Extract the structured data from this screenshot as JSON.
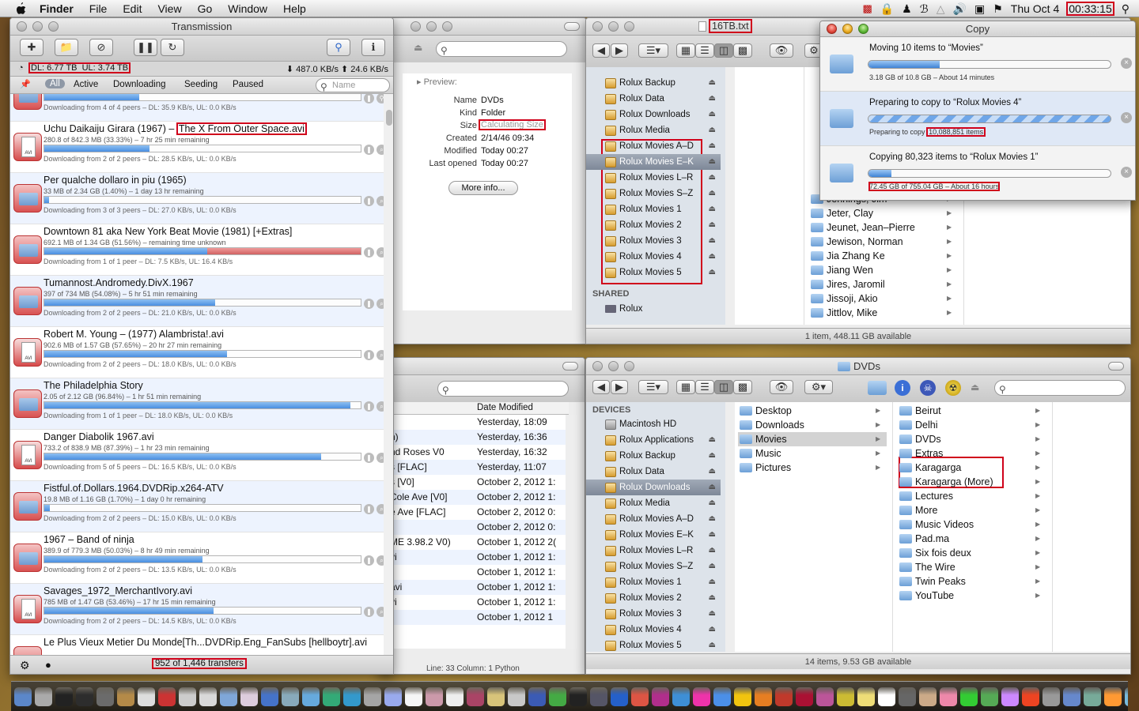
{
  "menubar": {
    "app": "Finder",
    "menus": [
      "File",
      "Edit",
      "View",
      "Go",
      "Window",
      "Help"
    ],
    "clock_date": "Thu Oct 4",
    "clock_time": "00:33:15"
  },
  "transmission": {
    "title": "Transmission",
    "totals": "DL: 6.77 TB  UL: 3.74 TB",
    "rates": "⬇ 487.0 KB/s ⬆ 24.6 KB/s",
    "filters": [
      "All",
      "Active",
      "Downloading",
      "Seeding",
      "Paused"
    ],
    "search_placeholder": "Name",
    "footer": "952 of 1,446 transfers",
    "top_partial_peer": "Downloading from 4 of 4 peers – DL: 35.9 KB/s, UL: 0.0 KB/s",
    "last_partial_name": "Le Plus Vieux Metier Du Monde[Th...DVDRip.Eng_FanSubs [hellboytr].avi",
    "torrents": [
      {
        "name_a": "Uchu Daikaiju Girara (1967) –",
        "name_b": "The X From Outer Space.avi",
        "stat": "280.8 of 842.3 MB (33.33%) – 7 hr 25 min remaining",
        "peer": "Downloading from 2 of 2 peers – DL: 28.5 KB/s, UL: 0.0 KB/s",
        "progress": 0.3333,
        "kind": "avi"
      },
      {
        "name_a": "Per qualche dollaro in piu (1965)",
        "name_b": "",
        "stat": "33 MB of 2.34 GB (1.40%) – 1 day 13 hr remaining",
        "peer": "Downloading from 3 of 3 peers – DL: 27.0 KB/s, UL: 0.0 KB/s",
        "progress": 0.014,
        "kind": "folder"
      },
      {
        "name_a": "Downtown 81 aka New York Beat Movie (1981) [+Extras]",
        "name_b": "",
        "stat": "692.1 MB of 1.34 GB (51.56%) – remaining time unknown",
        "peer": "Downloading from 1 of 1 peer – DL: 7.5 KB/s, UL: 16.4 KB/s",
        "progress": 0.5156,
        "kind": "folder"
      },
      {
        "name_a": "Tumannost.Andromedy.DivX.1967",
        "name_b": "",
        "stat": "397 of 734 MB (54.08%) – 5 hr 51 min remaining",
        "peer": "Downloading from 2 of 2 peers – DL: 21.0 KB/s, UL: 0.0 KB/s",
        "progress": 0.5408,
        "kind": "folder"
      },
      {
        "name_a": "Robert M. Young – (1977) Alambrista!.avi",
        "name_b": "",
        "stat": "902.6 MB of 1.57 GB (57.65%) – 20 hr 27 min remaining",
        "peer": "Downloading from 2 of 2 peers – DL: 18.0 KB/s, UL: 0.0 KB/s",
        "progress": 0.5765,
        "kind": "avi"
      },
      {
        "name_a": "The Philadelphia Story",
        "name_b": "",
        "stat": "2.05 of 2.12 GB (96.84%) – 1 hr 51 min remaining",
        "peer": "Downloading from 1 of 1 peer – DL: 18.0 KB/s, UL: 0.0 KB/s",
        "progress": 0.9684,
        "kind": "folder"
      },
      {
        "name_a": "Danger Diabolik 1967.avi",
        "name_b": "",
        "stat": "733.2 of 838.9 MB (87.39%) – 1 hr 23 min remaining",
        "peer": "Downloading from 5 of 5 peers – DL: 16.5 KB/s, UL: 0.0 KB/s",
        "progress": 0.8739,
        "kind": "avi"
      },
      {
        "name_a": "Fistful.of.Dollars.1964.DVDRip.x264-ATV",
        "name_b": "",
        "stat": "19.8 MB of 1.16 GB (1.70%) – 1 day 0 hr remaining",
        "peer": "Downloading from 2 of 2 peers – DL: 15.0 KB/s, UL: 0.0 KB/s",
        "progress": 0.017,
        "kind": "folder"
      },
      {
        "name_a": "1967 – Band of ninja",
        "name_b": "",
        "stat": "389.9 of 779.3 MB (50.03%) – 8 hr 49 min remaining",
        "peer": "Downloading from 2 of 2 peers – DL: 13.5 KB/s, UL: 0.0 KB/s",
        "progress": 0.5003,
        "kind": "folder"
      },
      {
        "name_a": "Savages_1972_MerchantIvory.avi",
        "name_b": "",
        "stat": "785 MB of 1.47 GB (53.46%) – 17 hr 15 min remaining",
        "peer": "Downloading from 2 of 2 peers – DL: 14.5 KB/s, UL: 0.0 KB/s",
        "progress": 0.5346,
        "kind": "avi"
      }
    ]
  },
  "info_window": {
    "preview_label": "▸ Preview:",
    "name_label": "Name",
    "name": "DVDs",
    "kind_label": "Kind",
    "kind": "Folder",
    "size_label": "Size",
    "size": "Calculating Size",
    "created_label": "Created",
    "created": "2/14/46 09:34",
    "modified_label": "Modified",
    "modified": "Today 00:27",
    "opened_label": "Last opened",
    "opened": "Today 00:27",
    "more_info": "More info..."
  },
  "top_finder": {
    "file_title": "16TB.txt",
    "sidebar": [
      "Rolux Backup",
      "Rolux Data",
      "Rolux Downloads",
      "Rolux Media",
      "Rolux Movies A–D",
      "Rolux Movies E–K",
      "Rolux Movies L–R",
      "Rolux Movies S–Z",
      "Rolux Movies 1",
      "Rolux Movies 2",
      "Rolux Movies 3",
      "Rolux Movies 4",
      "Rolux Movies 5"
    ],
    "shared_label": "SHARED",
    "shared_item": "Rolux",
    "people": [
      "Jennings, Jim",
      "Jeter, Clay",
      "Jeunet, Jean–Pierre",
      "Jewison, Norman",
      "Jia Zhang Ke",
      "Jiang Wen",
      "Jires, Jaromil",
      "Jissoji, Akio",
      "Jittlov, Mike"
    ],
    "status": "1 item, 448.11 GB available"
  },
  "copy": {
    "title": "Copy",
    "items": [
      {
        "title": "Moving 10 items to “Movies”",
        "sub_a": "3.18 GB of 10.8 GB – About 14 minutes",
        "sub_b": "",
        "progress": 0.294
      },
      {
        "title": "Preparing to copy to “Rolux Movies 4”",
        "sub_a": "Preparing to copy",
        "sub_b": "10,088,851 items",
        "progress": 1
      },
      {
        "title": "Copying 80,323 items to “Rolux Movies 1”",
        "sub_a": "72.45 GB of 755.04 GB – About 16 hours",
        "sub_b": "",
        "progress": 0.096
      }
    ]
  },
  "list_window": {
    "col_header": "Date Modified",
    "names": [
      "n)",
      "nd Roses V0",
      "s [FLAC]",
      "s [V0]",
      "Cole Ave [V0]",
      "e Ave [FLAC]",
      "",
      "ME 3.98.2 V0)",
      "vi",
      "",
      "avi",
      "vi"
    ],
    "dates": [
      "Yesterday, 18:09",
      "Yesterday, 16:36",
      "Yesterday, 16:32",
      "Yesterday, 11:07",
      "October 2, 2012 1:",
      "October 2, 2012 1:",
      "October 2, 2012 0:",
      "October 2, 2012 0:",
      "October 1, 2012 2(",
      "October 1, 2012 1:",
      "October 1, 2012 1:",
      "October 1, 2012 1:",
      "October 1, 2012 1:",
      "October 1, 2012 1"
    ],
    "bottom_text": "Line:  33  Column:  1  Python"
  },
  "bottom_finder": {
    "title": "DVDs",
    "devices_label": "DEVICES",
    "sidebar": [
      "Macintosh HD",
      "Rolux Applications",
      "Rolux Backup",
      "Rolux Data",
      "Rolux Downloads",
      "Rolux Media",
      "Rolux Movies A–D",
      "Rolux Movies E–K",
      "Rolux Movies L–R",
      "Rolux Movies S–Z",
      "Rolux Movies 1",
      "Rolux Movies 2",
      "Rolux Movies 3",
      "Rolux Movies 4",
      "Rolux Movies 5"
    ],
    "col1": [
      "Desktop",
      "Downloads",
      "Movies",
      "Music",
      "Pictures"
    ],
    "col2": [
      "Beirut",
      "Delhi",
      "DVDs",
      "Extras",
      "Karagarga",
      "Karagarga (More)",
      "Lectures",
      "More",
      "Music Videos",
      "Pad.ma",
      "Six fois deux",
      "The Wire",
      "Twin Peaks",
      "YouTube"
    ],
    "status": "14 items, 9.53 GB available"
  }
}
